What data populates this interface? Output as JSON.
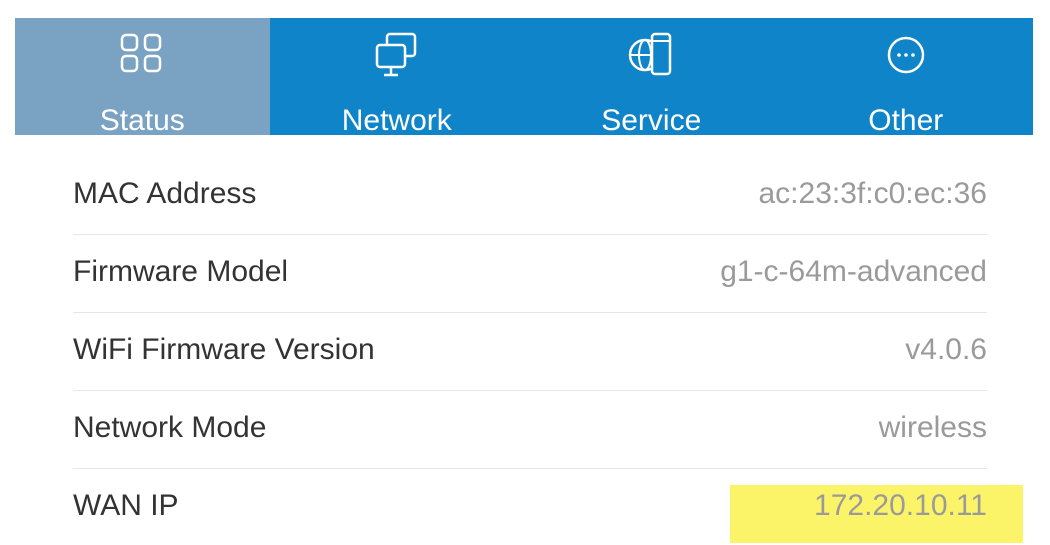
{
  "tabs": [
    {
      "label": "Status",
      "icon": "grid-icon",
      "active": true
    },
    {
      "label": "Network",
      "icon": "network-icon",
      "active": false
    },
    {
      "label": "Service",
      "icon": "globe-phone-icon",
      "active": false
    },
    {
      "label": "Other",
      "icon": "more-icon",
      "active": false
    }
  ],
  "info_rows": [
    {
      "key": "MAC Address",
      "value": "ac:23:3f:c0:ec:36"
    },
    {
      "key": "Firmware Model",
      "value": "g1-c-64m-advanced"
    },
    {
      "key": "WiFi Firmware Version",
      "value": "v4.0.6"
    },
    {
      "key": "Network Mode",
      "value": "wireless"
    },
    {
      "key": "WAN IP",
      "value": "172.20.10.11",
      "highlighted": true
    }
  ],
  "colors": {
    "tabbar_bg": "#0f84c8",
    "tab_active_bg": "#7aa3c3",
    "highlight": "#fcf468",
    "key_text": "#333333",
    "value_text": "#9a9a9a"
  }
}
